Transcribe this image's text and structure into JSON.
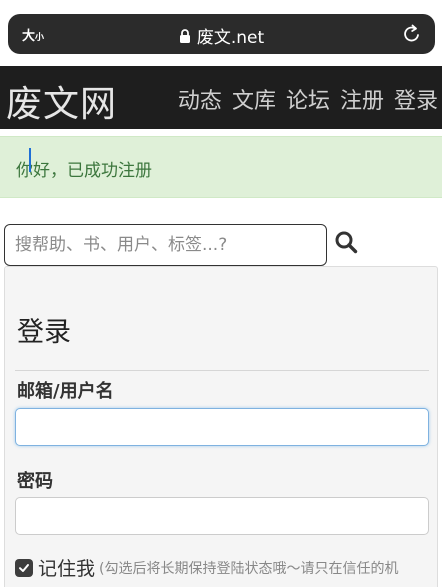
{
  "browser": {
    "text_size_label": "大",
    "text_size_small": "小",
    "url": "废文.net"
  },
  "site": {
    "logo": "废文网",
    "nav": [
      "动态",
      "文库",
      "论坛",
      "注册",
      "登录"
    ]
  },
  "alert": {
    "message": "你好，已成功注册"
  },
  "search": {
    "placeholder": "搜帮助、书、用户、标签...?"
  },
  "login": {
    "title": "登录",
    "username_label": "邮箱/用户名",
    "username_value": "",
    "password_label": "密码",
    "password_value": "",
    "remember_label": "记住我",
    "remember_hint": "(勾选后将长期保持登陆状态哦～请只在信任的机",
    "remember_checked": true
  }
}
